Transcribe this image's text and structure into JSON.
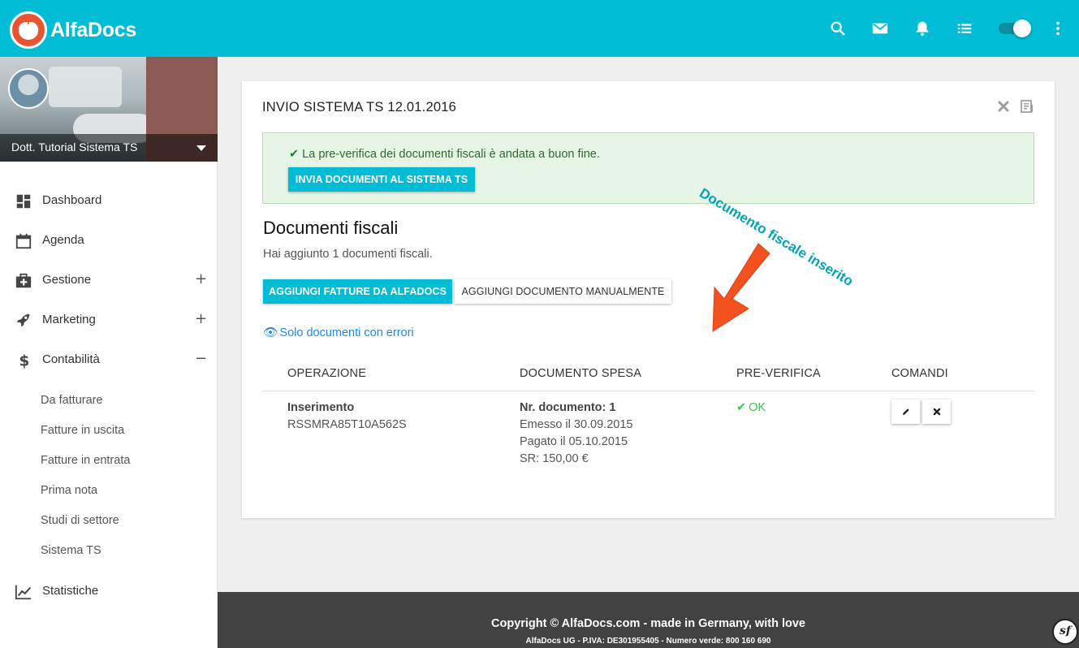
{
  "app": {
    "name": "AlfaDocs"
  },
  "topbar": {
    "icons": [
      "search-icon",
      "mail-icon",
      "bell-icon",
      "list-icon",
      "toggle-switch",
      "more-vert-icon"
    ]
  },
  "profile": {
    "name": "Dott. Tutorial Sistema TS"
  },
  "sidebar": {
    "items": [
      {
        "label": "Dashboard",
        "icon": "dashboard-icon"
      },
      {
        "label": "Agenda",
        "icon": "calendar-icon"
      },
      {
        "label": "Gestione",
        "icon": "medical-kit-icon",
        "toggle": "+"
      },
      {
        "label": "Marketing",
        "icon": "rocket-icon",
        "toggle": "+"
      },
      {
        "label": "Contabilità",
        "icon": "dollar-icon",
        "toggle": "−"
      },
      {
        "label": "Statistiche",
        "icon": "chart-line-icon"
      }
    ],
    "sub_items": [
      "Da fatturare",
      "Fatture in uscita",
      "Fatture in entrata",
      "Prima nota",
      "Studi di settore",
      "Sistema TS"
    ]
  },
  "card": {
    "title": "INVIO SISTEMA TS 12.01.2016",
    "alert_message": "La pre-verifica dei documenti fiscali è andata a buon fine.",
    "alert_button": "INVIA DOCUMENTI AL SISTEMA TS",
    "section_title": "Documenti fiscali",
    "section_sub": "Hai aggiunto 1 documenti fiscali.",
    "btn_add_alfadocs": "AGGIUNGI FATTURE DA ALFADOCS",
    "btn_add_manual": "AGGIUNGI DOCUMENTO MANUALMENTE",
    "filter_link": "Solo documenti con errori",
    "table": {
      "headers": [
        "OPERAZIONE",
        "DOCUMENTO SPESA",
        "PRE-VERIFICA",
        "COMANDI"
      ],
      "row": {
        "operation": "Inserimento",
        "code": "RSSMRA85T10A562S",
        "doc_number": "Nr. documento: 1",
        "issued": "Emesso il 30.09.2015",
        "paid": "Pagato il 05.10.2015",
        "sr": "SR: 150,00 €",
        "status": "OK"
      }
    }
  },
  "annotation": {
    "text": "Documento fiscale inserito"
  },
  "footer": {
    "copyright": "Copyright © AlfaDocs.com - made in Germany, with love",
    "legal": "AlfaDocs UG - P.IVA: DE301955405 - Numero verde: 800 160 690"
  },
  "colors": {
    "primary": "#00bcd4",
    "success_bg": "#e6f5e6",
    "ok": "#2ecc40",
    "link": "#1e88e5",
    "footer": "#424242",
    "arrow": "#f4511e"
  }
}
